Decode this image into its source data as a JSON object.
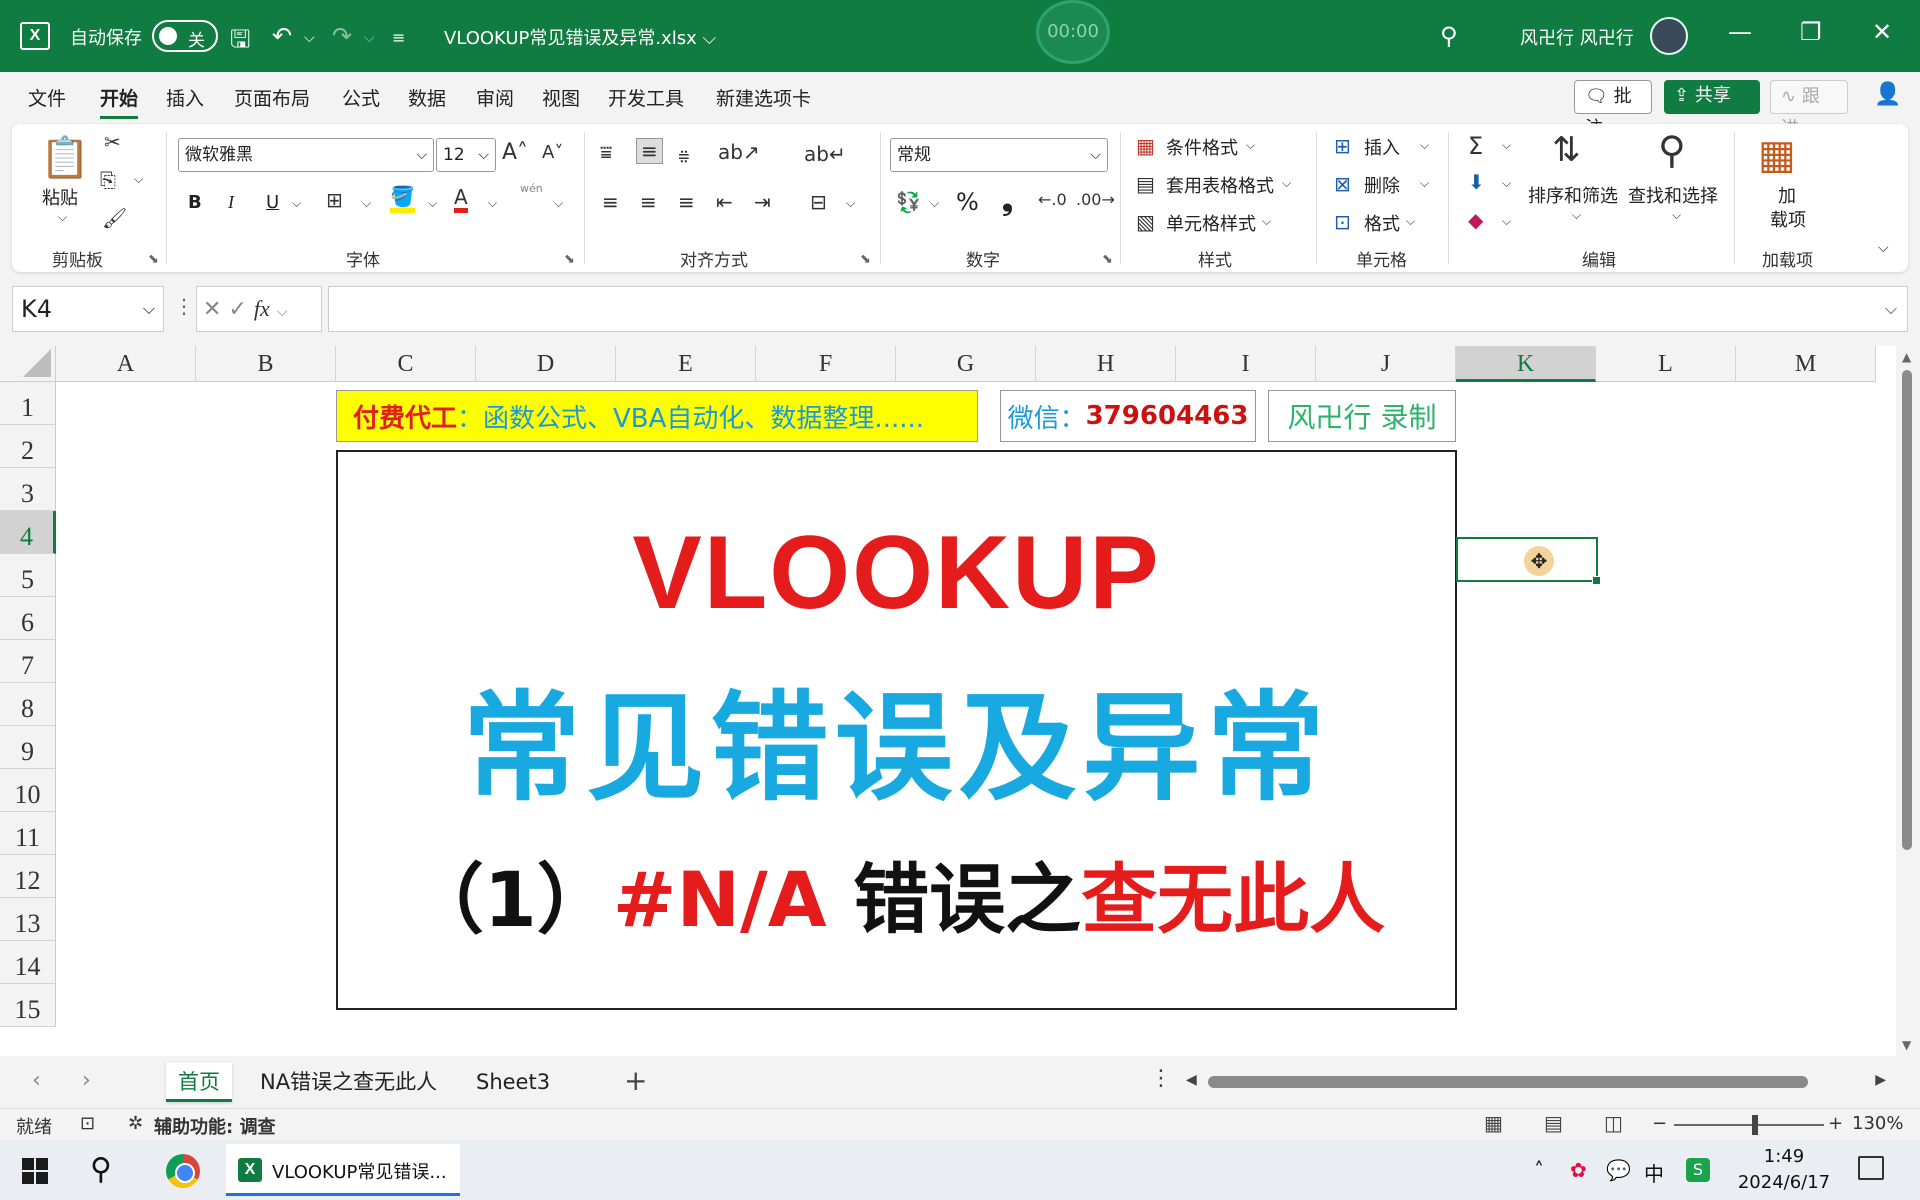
{
  "titlebar": {
    "autosave_label": "自动保存",
    "autosave_state": "关",
    "doc_title": "VLOOKUP常见错误及异常.xlsx ⌵",
    "timer": "00:00",
    "user": "风卍行 风卍行"
  },
  "menu": {
    "tabs": [
      "文件",
      "开始",
      "插入",
      "页面布局",
      "公式",
      "数据",
      "审阅",
      "视图",
      "开发工具",
      "新建选项卡"
    ],
    "active": "开始",
    "comment": "批注",
    "share": "共享 ⌵",
    "follow": "跟进"
  },
  "ribbon": {
    "clipboard": {
      "paste": "粘贴",
      "label": "剪贴板"
    },
    "font": {
      "name": "微软雅黑",
      "size": "12",
      "label": "字体",
      "bold": "B",
      "italic": "I",
      "underline": "U",
      "phonetic": "wén"
    },
    "align": {
      "label": "对齐方式"
    },
    "number": {
      "format": "常规",
      "label": "数字",
      "percent": "%",
      "comma": "❟"
    },
    "styles": {
      "cond": "条件格式",
      "table": "套用表格格式",
      "cell": "单元格样式",
      "label": "样式"
    },
    "cells": {
      "insert": "插入",
      "delete": "删除",
      "format": "格式",
      "label": "单元格"
    },
    "edit": {
      "sort": "排序和筛选",
      "find": "查找和选择",
      "label": "编辑"
    },
    "addins": {
      "line1": "加",
      "line2": "载项",
      "label": "加载项"
    }
  },
  "formula": {
    "cell_ref": "K4",
    "value": ""
  },
  "grid": {
    "columns": [
      "A",
      "B",
      "C",
      "D",
      "E",
      "F",
      "G",
      "H",
      "I",
      "J",
      "K",
      "L",
      "M"
    ],
    "rows": [
      "1",
      "2",
      "3",
      "4",
      "5",
      "6",
      "7",
      "8",
      "9",
      "10",
      "11",
      "12",
      "13",
      "14",
      "15"
    ],
    "selected_col": "K",
    "selected_row": "4"
  },
  "banner": {
    "ad_highlight": "付费代工",
    "ad_rest": "：函数公式、VBA自动化、数据整理......",
    "wechat_label": "微信：",
    "wechat_number": "379604463",
    "recorder": "风卍行 录制"
  },
  "hero": {
    "line1": "VLOOKUP",
    "line2": "常见错误及异常",
    "line3_prefix": "（1）",
    "line3_code": "#N/A",
    "line3_mid": " 错误之",
    "line3_end": "查无此人"
  },
  "sheets": {
    "tabs": [
      "首页",
      "NA错误之查无此人",
      "Sheet3"
    ],
    "active": "首页"
  },
  "status": {
    "ready": "就绪",
    "accessibility": "辅助功能: 调查",
    "zoom": "130%"
  },
  "taskbar": {
    "excel_label": "VLOOKUP常见错误...",
    "ime": "中",
    "time": "1:49",
    "date": "2024/6/17"
  },
  "colors": {
    "excel_green": "#107c41",
    "hero_red": "#e51c1c",
    "hero_blue": "#19a9e1",
    "banner_yellow": "#ffff00"
  }
}
